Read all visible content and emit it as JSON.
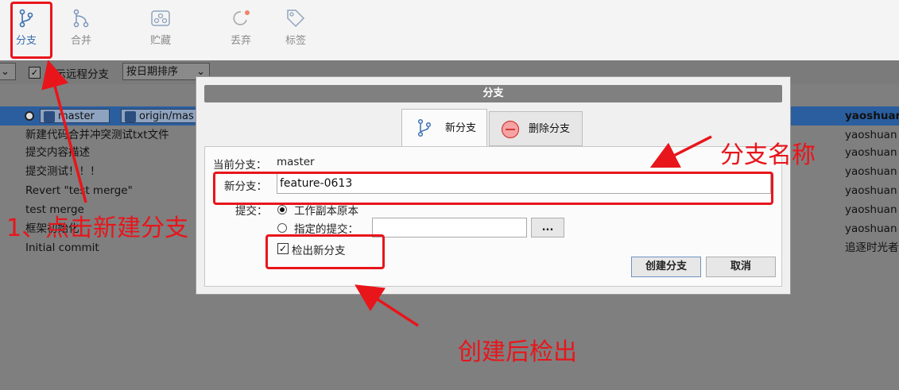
{
  "toolbar": {
    "branch": "分支",
    "merge": "合并",
    "stash": "贮藏",
    "discard": "丢弃",
    "tag": "标签"
  },
  "filter": {
    "show_remote": "显示远程分支",
    "sort": "按日期排序"
  },
  "commits": [
    {
      "message": "",
      "author": "yaoshuan",
      "selected": true,
      "tags": [
        "master",
        "origin/mas"
      ]
    },
    {
      "message": "新建代码合并冲突测试txt文件",
      "author": "yaoshuan"
    },
    {
      "message": "提交内容描述",
      "author": "yaoshuan"
    },
    {
      "message": "提交测试！！！",
      "author": "yaoshuan"
    },
    {
      "message": "Revert \"test merge\"",
      "author": "yaoshuan"
    },
    {
      "message": "test merge",
      "author": "yaoshuan"
    },
    {
      "message": "框架初始化",
      "author": "yaoshuan"
    },
    {
      "message": "Initial commit",
      "author": "追逐时光者"
    }
  ],
  "dialog": {
    "title": "分支",
    "tab_new": "新分支",
    "tab_delete": "删除分支",
    "current_branch_label": "当前分支：",
    "current_branch_value": "master",
    "new_branch_label": "新分支：",
    "new_branch_value": "feature-0613",
    "commit_label": "提交：",
    "radio_working_copy": "工作副本原本",
    "radio_specified": "指定的提交：",
    "browse": "...",
    "checkout_label": "检出新分支",
    "create_button": "创建分支",
    "cancel_button": "取消"
  },
  "annotations": {
    "step1": "1、点击新建分支",
    "branch_name": "分支名称",
    "checkout_after": "创建后检出"
  },
  "colors": {
    "annotation_red": "#e8151b",
    "selection_blue": "#2a5e9f",
    "active_tool": "#3a6fb0"
  }
}
